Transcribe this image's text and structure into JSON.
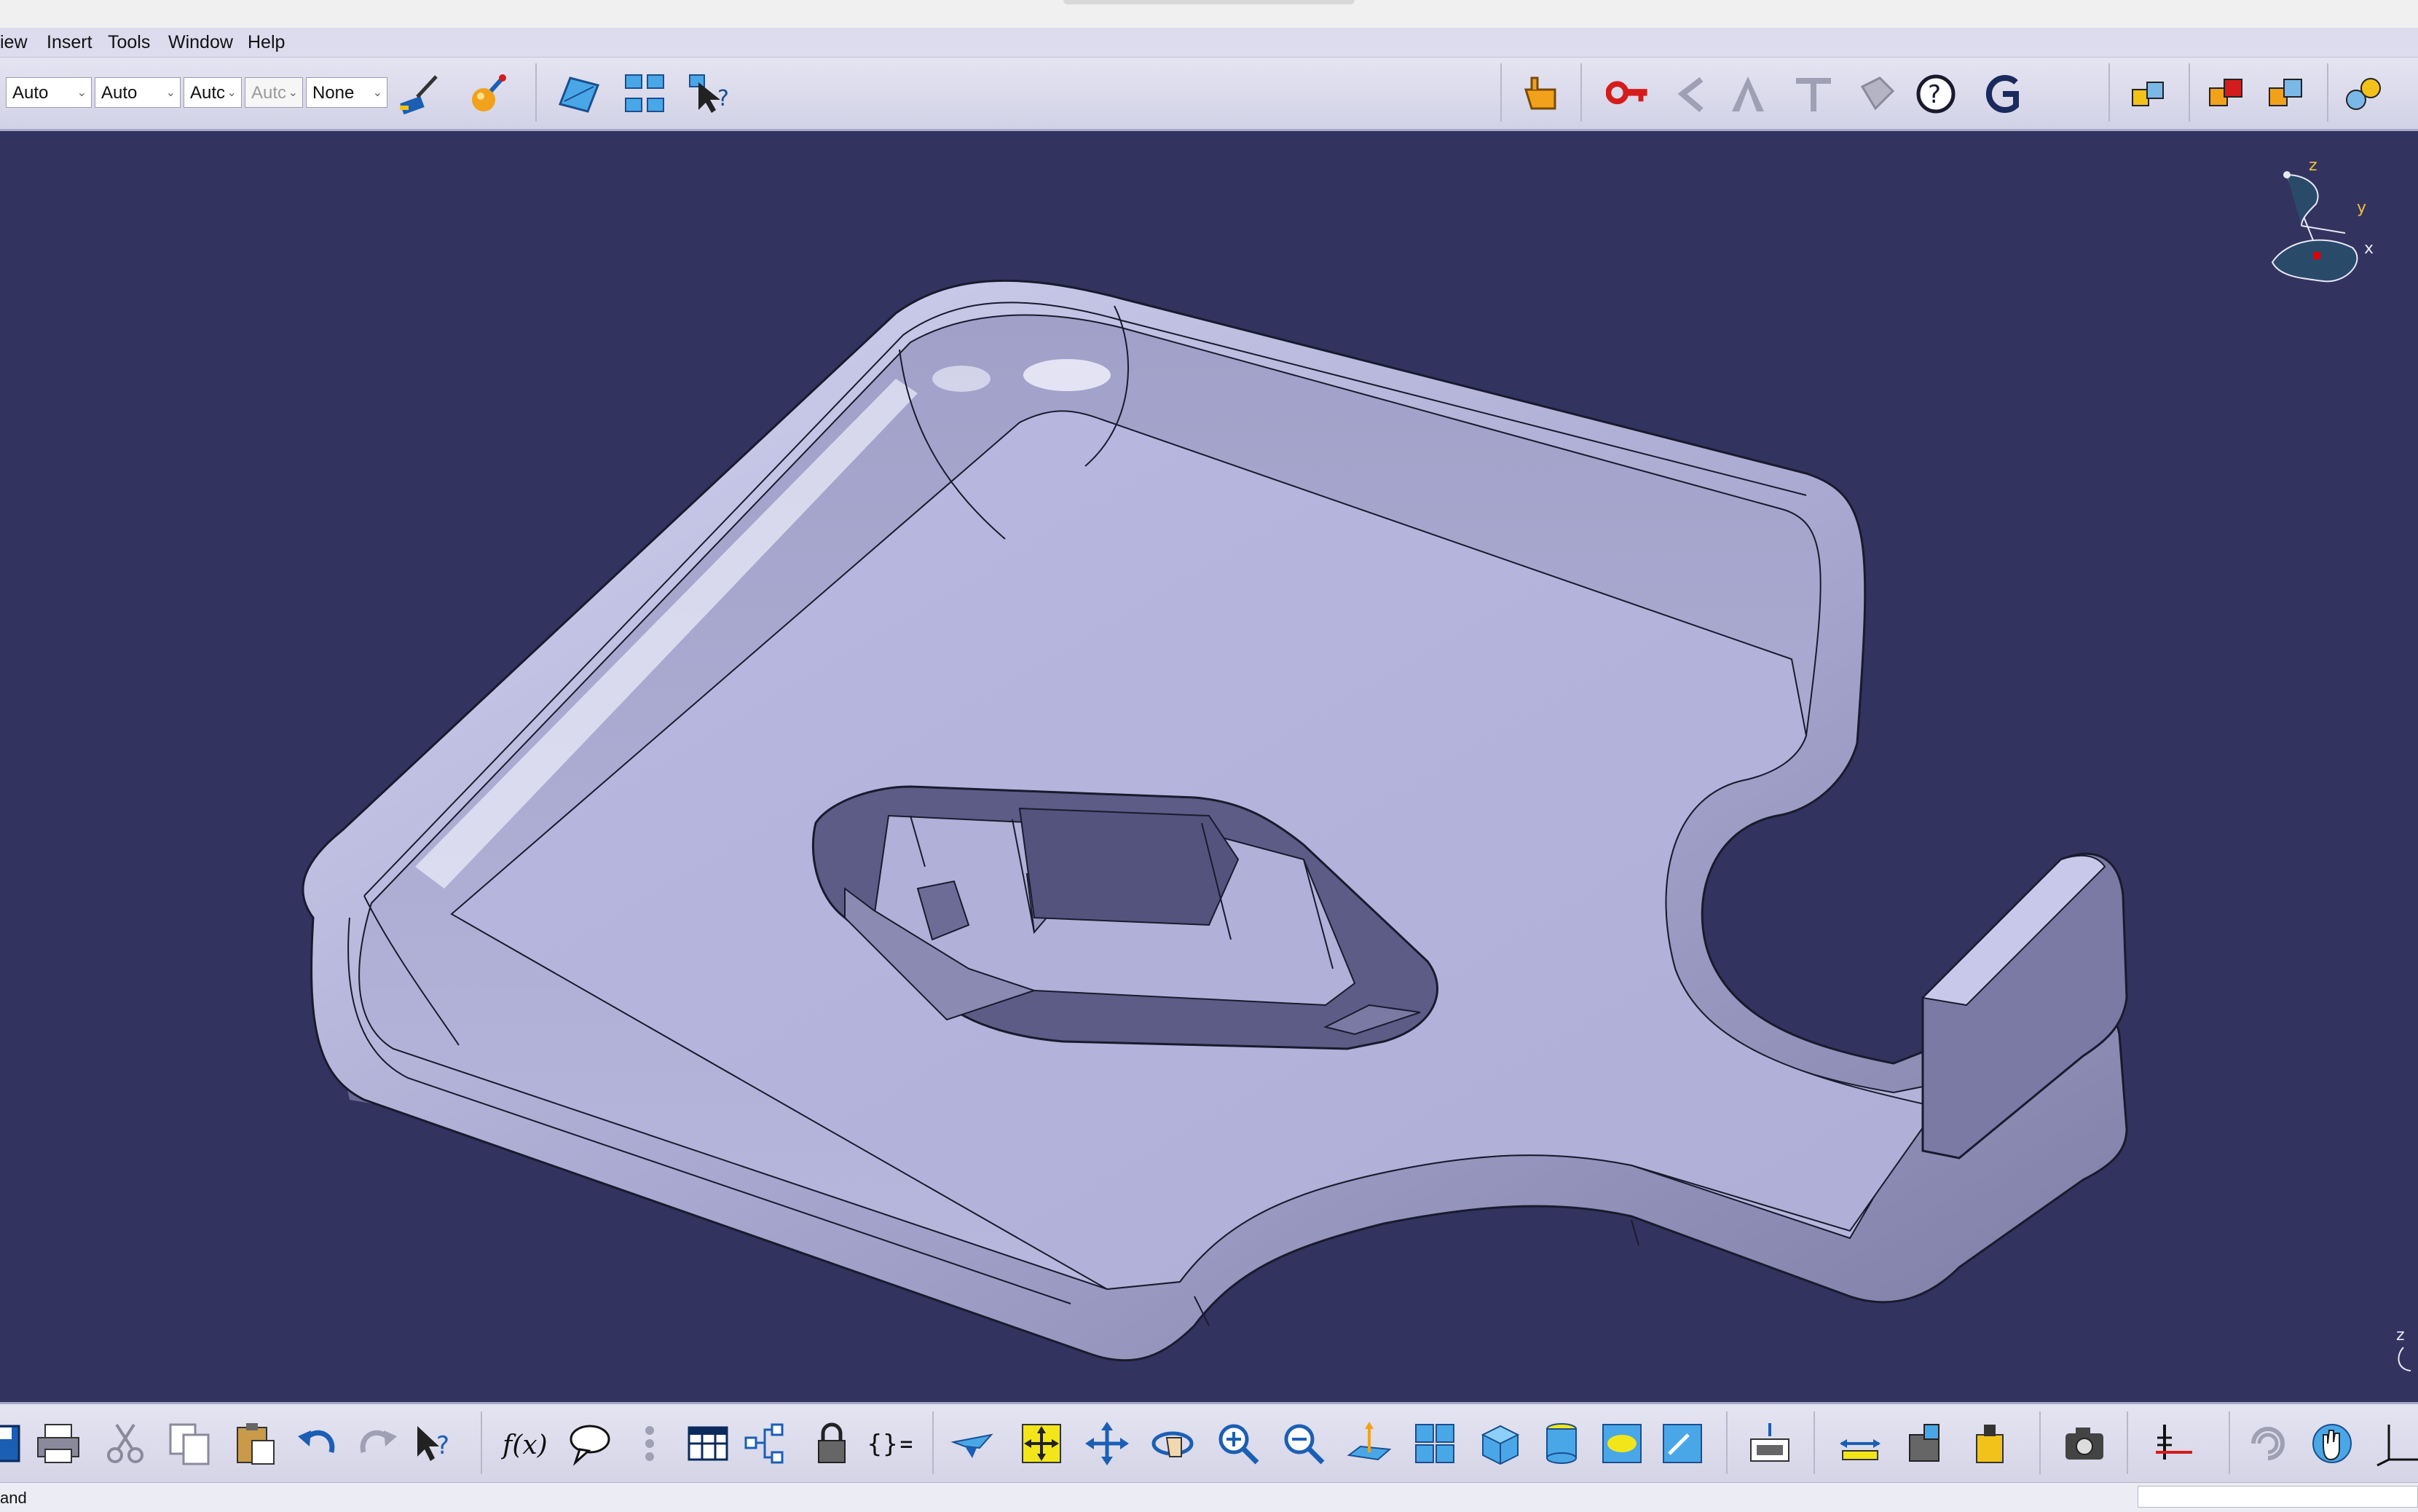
{
  "menubar": {
    "items": [
      {
        "label": "iew"
      },
      {
        "label": "Insert"
      },
      {
        "label": "Tools"
      },
      {
        "label": "Window"
      },
      {
        "label": "Help"
      }
    ]
  },
  "toolbar": {
    "combos": [
      {
        "value": "Auto"
      },
      {
        "value": "Auto"
      },
      {
        "value": "Autc"
      },
      {
        "value": "Autc",
        "disabled": true
      },
      {
        "value": "None"
      }
    ]
  },
  "compass": {
    "x_label": "x",
    "y_label": "y",
    "z_label": "z"
  },
  "viewport": {
    "corner_axis_label": "z"
  },
  "status": {
    "text": "and"
  },
  "colors": {
    "viewport_background": "#33335f",
    "part_face": "#b4b4de",
    "toolbar_background": "#d8d8ea",
    "accent_blue": "#1b5fb5",
    "accent_orange": "#f2a21a",
    "accent_red": "#d41c1c"
  }
}
